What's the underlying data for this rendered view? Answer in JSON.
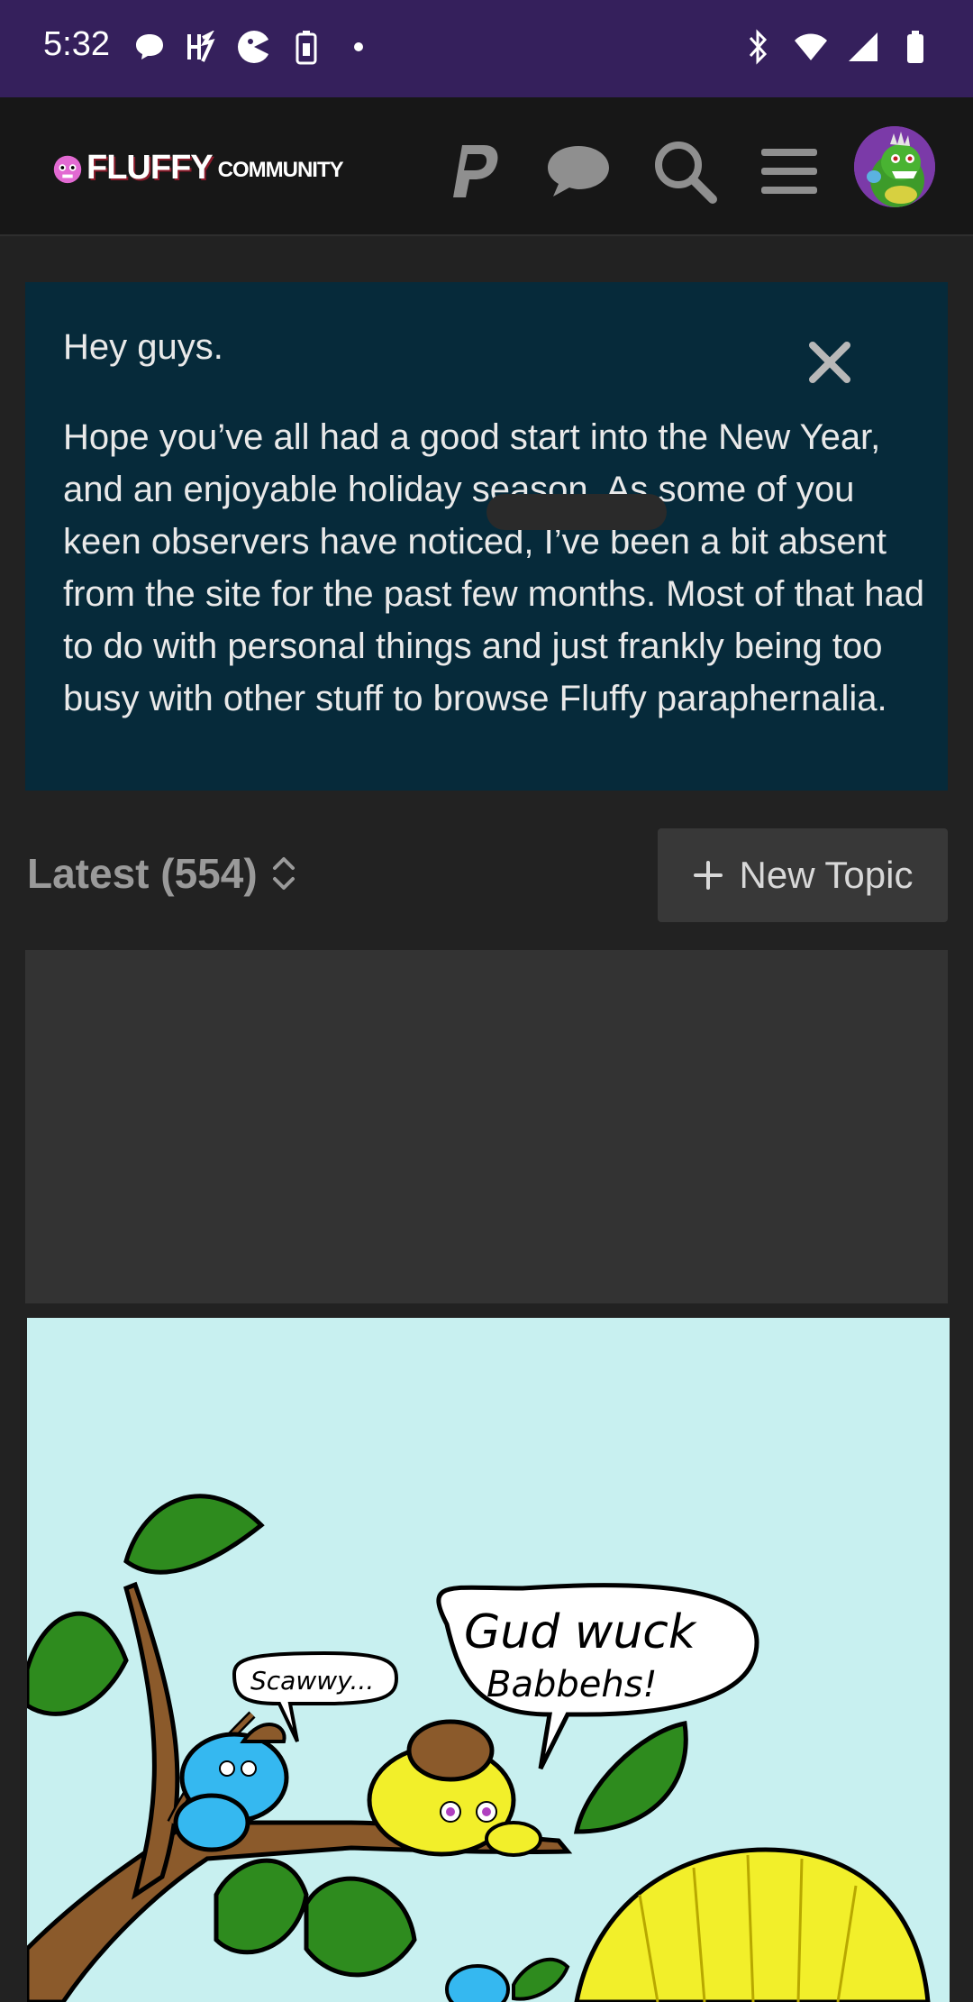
{
  "status_bar": {
    "time": "5:32",
    "icons_left": [
      "chat-bubble-icon",
      "harry-potter-icon",
      "pac-icon",
      "battery-saver-icon",
      "dot-icon"
    ],
    "icons_right": [
      "bluetooth-icon",
      "wifi-icon",
      "signal-icon",
      "battery-icon"
    ],
    "background": "#35205c"
  },
  "header": {
    "logo_main": "FLUFFY",
    "logo_sub": "COMMUNITY",
    "buttons": [
      "paypal-icon",
      "chat-icon",
      "search-icon",
      "hamburger-menu-icon"
    ],
    "avatar_icon": "dragon-avatar-icon"
  },
  "banner": {
    "greeting": "Hey guys.",
    "body": "Hope you’ve all had a good start into the New Year, and an enjoyable holiday season. As some of you keen observers have noticed, I’ve been a bit absent from the site for the past few months. Most of that had to do with personal things and just frankly being too busy with other stuff to browse Fluffy paraphernalia.",
    "close_icon": "close-icon",
    "background": "#062a3a"
  },
  "topics": {
    "title": "Latest (554)",
    "sort_icon": "sort-toggle-icon",
    "new_topic_label": "New Topic",
    "new_topic_icon": "plus-icon"
  },
  "comic": {
    "bubble_left": "Scawwy...",
    "bubble_right_line1": "Gud wuck",
    "bubble_right_line2": "Babbehs!",
    "background": "#c8f0f0"
  }
}
